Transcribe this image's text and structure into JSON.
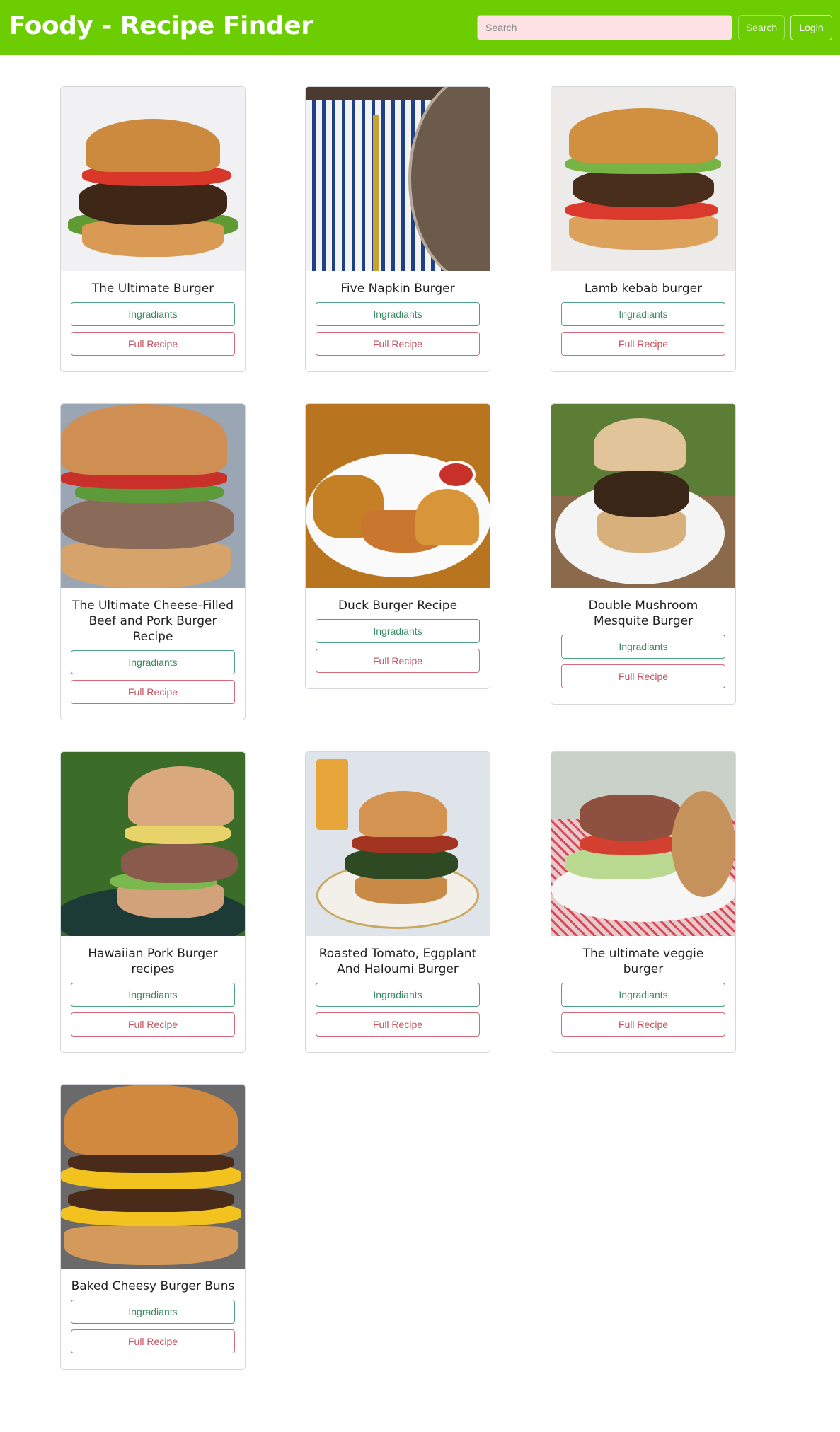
{
  "app": {
    "title": "Foody - Recipe Finder",
    "brand_color": "#6ccd02"
  },
  "search": {
    "placeholder": "Search",
    "value": "",
    "button_label": "Search"
  },
  "login": {
    "label": "Login"
  },
  "recipes": [
    {
      "title": "The Ultimate Burger",
      "ingredients_label": "Ingradiants",
      "full_label": "Full Recipe"
    },
    {
      "title": "Five Napkin Burger",
      "ingredients_label": "Ingradiants",
      "full_label": "Full Recipe"
    },
    {
      "title": "Lamb kebab burger",
      "ingredients_label": "Ingradiants",
      "full_label": "Full Recipe"
    },
    {
      "title": "The Ultimate Cheese-Filled Beef and Pork Burger Recipe",
      "ingredients_label": "Ingradiants",
      "full_label": "Full Recipe"
    },
    {
      "title": "Duck Burger Recipe",
      "ingredients_label": "Ingradiants",
      "full_label": "Full Recipe"
    },
    {
      "title": "Double Mushroom Mesquite Burger",
      "ingredients_label": "Ingradiants",
      "full_label": "Full Recipe"
    },
    {
      "title": "Hawaiian Pork Burger recipes",
      "ingredients_label": "Ingradiants",
      "full_label": "Full Recipe"
    },
    {
      "title": "Roasted Tomato, Eggplant And Haloumi Burger",
      "ingredients_label": "Ingradiants",
      "full_label": "Full Recipe"
    },
    {
      "title": "The ultimate veggie burger",
      "ingredients_label": "Ingradiants",
      "full_label": "Full Recipe"
    },
    {
      "title": "Baked Cheesy Burger Buns",
      "ingredients_label": "Ingradiants",
      "full_label": "Full Recipe"
    }
  ]
}
